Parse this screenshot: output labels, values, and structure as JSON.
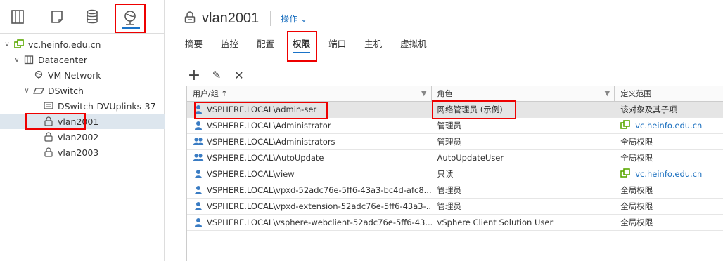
{
  "nav": {
    "icons": [
      "hosts-clusters-icon",
      "vms-templates-icon",
      "storage-icon",
      "networking-icon"
    ]
  },
  "tree": {
    "items": [
      {
        "label": "vc.heinfo.edu.cn",
        "level": 0,
        "caret": "∨",
        "icon": "vcenter-icon"
      },
      {
        "label": "Datacenter",
        "level": 1,
        "caret": "∨",
        "icon": "datacenter-icon"
      },
      {
        "label": "VM Network",
        "level": 2,
        "caret": "",
        "icon": "network-icon"
      },
      {
        "label": "DSwitch",
        "level": 2,
        "caret": "∨",
        "icon": "dswitch-icon"
      },
      {
        "label": "DSwitch-DVUplinks-37",
        "level": 3,
        "caret": "",
        "icon": "uplink-icon"
      },
      {
        "label": "vlan2001",
        "level": 3,
        "caret": "",
        "icon": "portgroup-icon",
        "selected": true
      },
      {
        "label": "vlan2002",
        "level": 3,
        "caret": "",
        "icon": "portgroup-icon"
      },
      {
        "label": "vlan2003",
        "level": 3,
        "caret": "",
        "icon": "portgroup-icon"
      }
    ]
  },
  "header": {
    "title": "vlan2001",
    "actions_label": "操作 ⌄"
  },
  "tabs": [
    "摘要",
    "监控",
    "配置",
    "权限",
    "端口",
    "主机",
    "虚拟机"
  ],
  "active_tab": "权限",
  "toolbar": {
    "add": "+",
    "edit": "✎",
    "remove": "✕"
  },
  "table": {
    "headers": [
      "用户/组 ↑",
      "角色",
      "定义范围"
    ],
    "rows": [
      {
        "user": "VSPHERE.LOCAL\\admin-ser",
        "role": "网络管理员 (示例)",
        "scope": "该对象及其子项",
        "scope_link": false,
        "group": false,
        "selected": true
      },
      {
        "user": "VSPHERE.LOCAL\\Administrator",
        "role": "管理员",
        "scope": "vc.heinfo.edu.cn",
        "scope_link": true,
        "group": false
      },
      {
        "user": "VSPHERE.LOCAL\\Administrators",
        "role": "管理员",
        "scope": "全局权限",
        "scope_link": false,
        "group": true
      },
      {
        "user": "VSPHERE.LOCAL\\AutoUpdate",
        "role": "AutoUpdateUser",
        "scope": "全局权限",
        "scope_link": false,
        "group": true
      },
      {
        "user": "VSPHERE.LOCAL\\view",
        "role": "只读",
        "scope": "vc.heinfo.edu.cn",
        "scope_link": true,
        "group": false
      },
      {
        "user": "VSPHERE.LOCAL\\vpxd-52adc76e-5ff6-43a3-bc4d-afc8...",
        "role": "管理员",
        "scope": "全局权限",
        "scope_link": false,
        "group": false
      },
      {
        "user": "VSPHERE.LOCAL\\vpxd-extension-52adc76e-5ff6-43a3-...",
        "role": "管理员",
        "scope": "全局权限",
        "scope_link": false,
        "group": false
      },
      {
        "user": "VSPHERE.LOCAL\\vsphere-webclient-52adc76e-5ff6-43...",
        "role": "vSphere Client Solution User",
        "scope": "全局权限",
        "scope_link": false,
        "group": false
      }
    ]
  },
  "colors": {
    "accent": "#1a73c8",
    "highlight": "#ee0000",
    "link": "#1a6fbf",
    "vcenter_green": "#5aa800"
  }
}
